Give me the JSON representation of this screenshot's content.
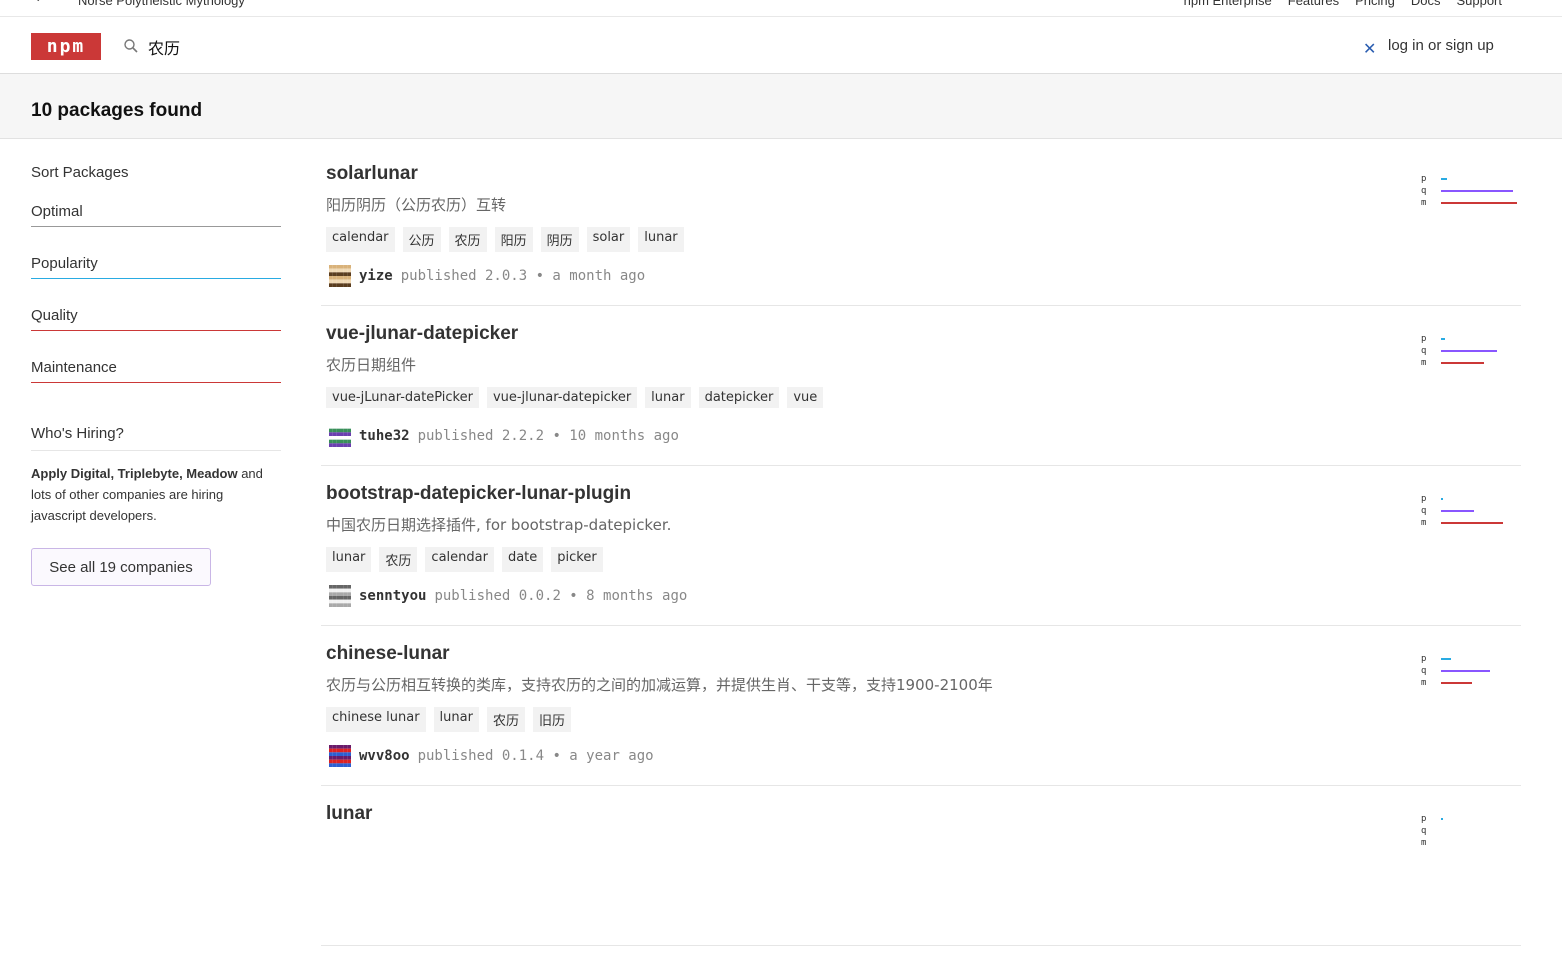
{
  "topbar": {
    "motto": "Norse Polytheistic Mythology",
    "nav": [
      "npm Enterprise",
      "Features",
      "Pricing",
      "Docs",
      "Support"
    ]
  },
  "header": {
    "logo_text": "npm",
    "search_value": "农历",
    "login_label": "log in or sign up"
  },
  "results_summary": "10 packages found",
  "sidebar": {
    "sort_title": "Sort Packages",
    "sort_options": [
      {
        "label": "Optimal",
        "color": "#999999"
      },
      {
        "label": "Popularity",
        "color": "#29abe2"
      },
      {
        "label": "Quality",
        "color": "#cb3837"
      },
      {
        "label": "Maintenance",
        "color": "#cb3837"
      }
    ],
    "hiring_title": "Who's Hiring?",
    "hiring_companies": "Apply Digital, Triplebyte, Meadow",
    "hiring_rest": " and lots of other companies are hiring javascript developers.",
    "see_all_label": "See all 19 companies"
  },
  "score_labels": {
    "p": "p",
    "q": "q",
    "m": "m"
  },
  "packages": [
    {
      "name": "solarlunar",
      "description": "阳历阴历（公历农历）互转",
      "keywords": [
        "calendar",
        "公历",
        "农历",
        "阳历",
        "阴历",
        "solar",
        "lunar"
      ],
      "publisher": "yize",
      "published_text": "published 2.0.3 • a month ago",
      "scores": {
        "p": 0.06,
        "q": 0.72,
        "m": 0.76
      }
    },
    {
      "name": "vue-jlunar-datepicker",
      "description": "农历日期组件",
      "keywords": [
        "vue-jLunar-datePicker",
        "vue-jlunar-datepicker",
        "lunar",
        "datepicker",
        "vue"
      ],
      "publisher": "tuhe32",
      "published_text": "published 2.2.2 • 10 months ago",
      "scores": {
        "p": 0.04,
        "q": 0.56,
        "m": 0.43
      }
    },
    {
      "name": "bootstrap-datepicker-lunar-plugin",
      "description": "中国农历日期选择插件, for bootstrap-datepicker.",
      "keywords": [
        "lunar",
        "农历",
        "calendar",
        "date",
        "picker"
      ],
      "publisher": "senntyou",
      "published_text": "published 0.0.2 • 8 months ago",
      "scores": {
        "p": 0.02,
        "q": 0.33,
        "m": 0.62
      }
    },
    {
      "name": "chinese-lunar",
      "description": "农历与公历相互转换的类库，支持农历的之间的加减运算，并提供生肖、干支等，支持1900-2100年",
      "keywords": [
        "chinese lunar",
        "lunar",
        "农历",
        "旧历"
      ],
      "publisher": "wvv8oo",
      "published_text": "published 0.1.4 • a year ago",
      "scores": {
        "p": 0.1,
        "q": 0.49,
        "m": 0.31
      }
    },
    {
      "name": "lunar",
      "description": "",
      "keywords": [],
      "publisher": "",
      "published_text": "",
      "scores": {
        "p": 0.02,
        "q": 0,
        "m": 0
      }
    }
  ],
  "colors": {
    "brand": "#cb3837",
    "popularity": "#29abe2",
    "quality": "#8956ff",
    "maintenance": "#cb3837"
  }
}
